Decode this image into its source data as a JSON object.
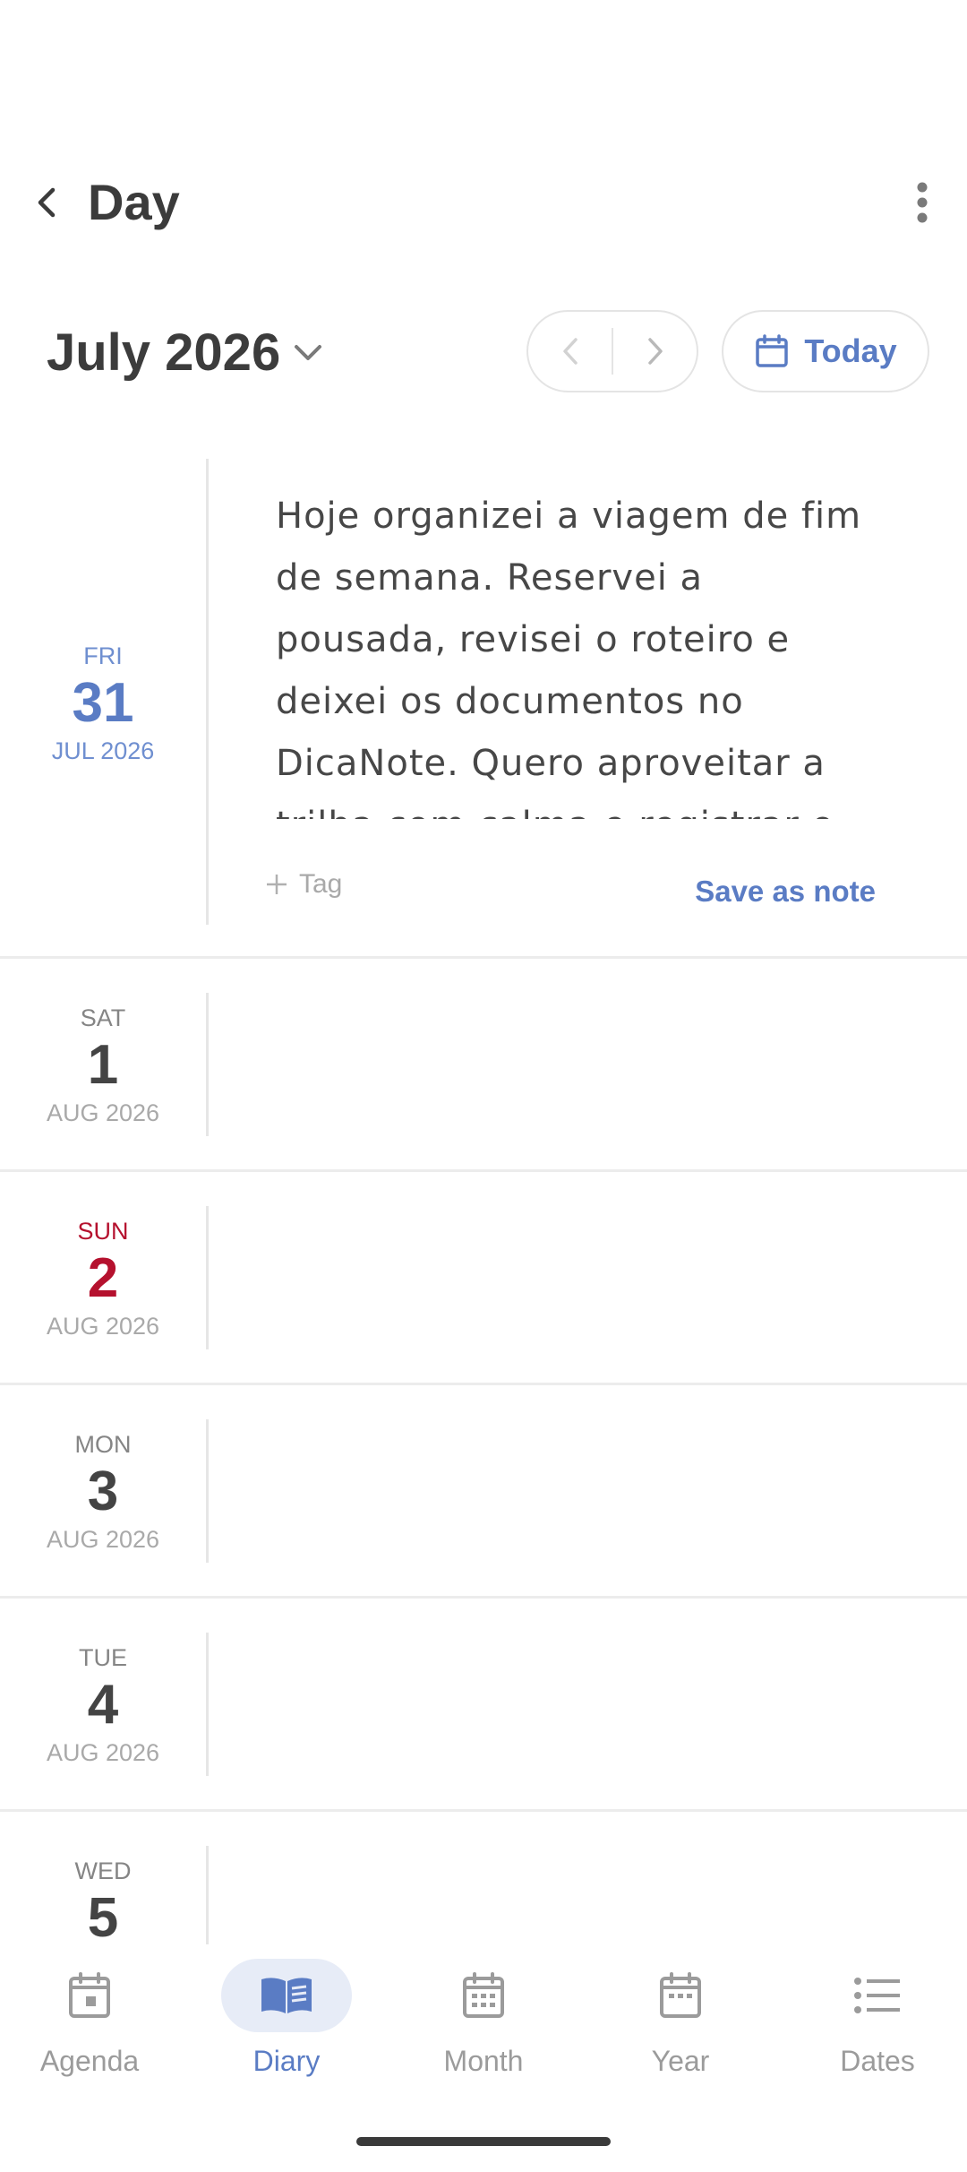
{
  "header": {
    "title": "Day"
  },
  "month_bar": {
    "month_label": "July 2026",
    "today_label": "Today"
  },
  "entries": [
    {
      "dow": "FRI",
      "day": "31",
      "month_year": "JUL 2026",
      "text": "Hoje organizei a viagem de fim de semana. Reservei a pousada, revisei o roteiro e deixei os documentos no DicaNote. Quero aproveitar a trilha com calma e registrar o pôr do sol no mirante.",
      "tag_label": "Tag",
      "save_label": "Save as note"
    },
    {
      "dow": "SAT",
      "day": "1",
      "month_year": "AUG 2026"
    },
    {
      "dow": "SUN",
      "day": "2",
      "month_year": "AUG 2026"
    },
    {
      "dow": "MON",
      "day": "3",
      "month_year": "AUG 2026"
    },
    {
      "dow": "TUE",
      "day": "4",
      "month_year": "AUG 2026"
    },
    {
      "dow": "WED",
      "day": "5"
    }
  ],
  "bottom_nav": {
    "items": [
      {
        "label": "Agenda",
        "icon": "agenda-icon"
      },
      {
        "label": "Diary",
        "icon": "diary-book-icon",
        "active": true
      },
      {
        "label": "Month",
        "icon": "month-calendar-icon"
      },
      {
        "label": "Year",
        "icon": "year-calendar-icon"
      },
      {
        "label": "Dates",
        "icon": "dates-list-icon"
      }
    ]
  },
  "colors": {
    "accent": "#5a7cc4",
    "sunday": "#b5112e",
    "active_nav_bg": "#e7ecf7"
  }
}
